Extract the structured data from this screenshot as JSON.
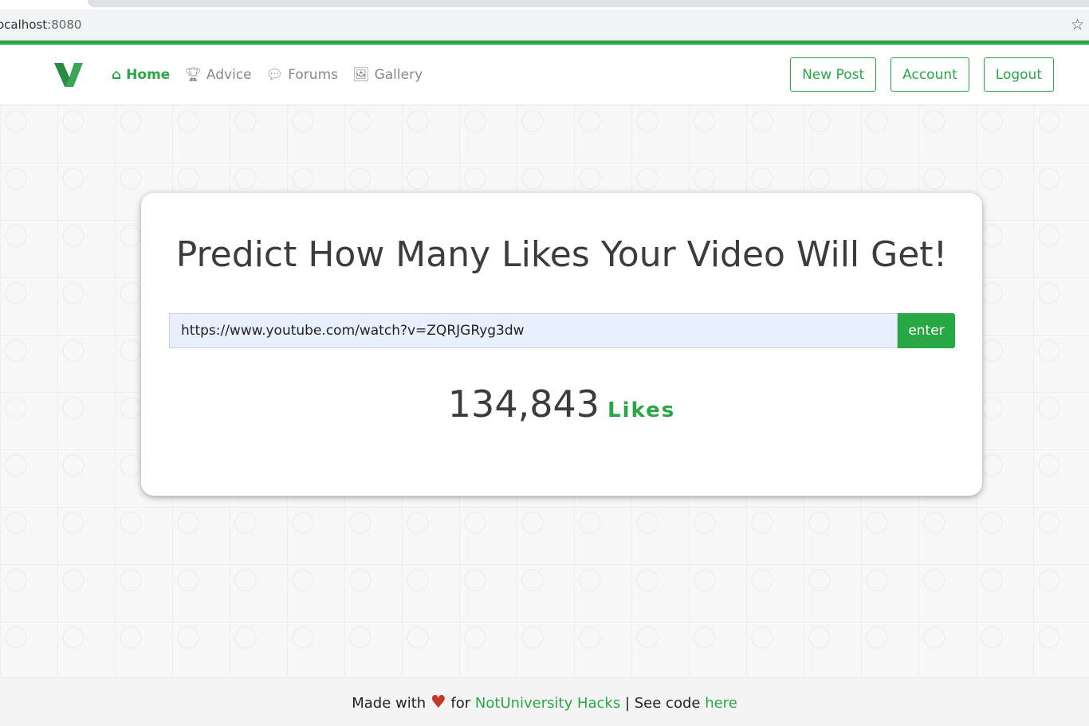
{
  "browser": {
    "host": "ocalhost",
    "port": ":8080"
  },
  "nav": {
    "items": [
      {
        "label": "Home",
        "icon": "home-icon"
      },
      {
        "label": "Advice",
        "icon": "trophy-icon"
      },
      {
        "label": "Forums",
        "icon": "comments-icon"
      },
      {
        "label": "Gallery",
        "icon": "images-icon"
      }
    ],
    "buttons": {
      "new_post": "New Post",
      "account": "Account",
      "logout": "Logout"
    }
  },
  "main": {
    "title": "Predict How Many Likes Your Video Will Get!",
    "url_value": "https://www.youtube.com/watch?v=ZQRJGRyg3dw",
    "enter": "enter",
    "count": "134,843",
    "likes_label": "Likes"
  },
  "footer": {
    "made_with": "Made with",
    "for": "for",
    "link1": "NotUniversity Hacks",
    "sep": "| See code",
    "link2": "here"
  },
  "colors": {
    "accent": "#28a745"
  }
}
